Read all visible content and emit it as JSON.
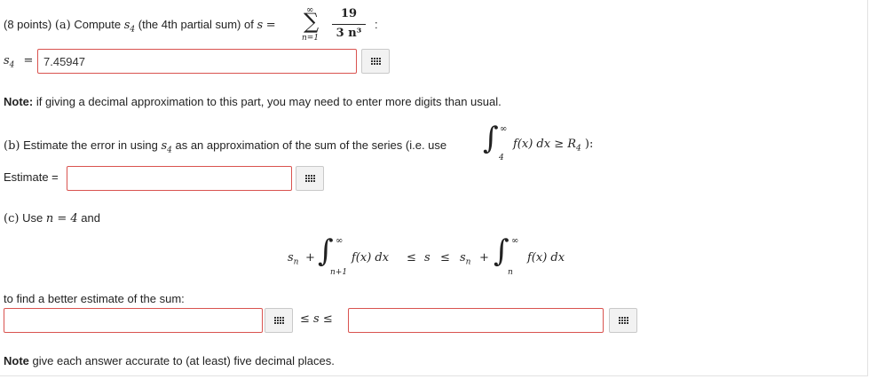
{
  "part_a": {
    "intro": "(8 points)",
    "label_a": "(a)",
    "text1": "Compute",
    "s4": "s",
    "sub4": "4",
    "text2": "(the 4th partial sum) of",
    "s": "s",
    "eq": "=",
    "sum_upper": "∞",
    "sum_lower": "n=1",
    "sigma": "∑",
    "num": "19",
    "den": "3 n³",
    "colon": ":",
    "answer_label_s": "s",
    "answer_label_sub": "4",
    "answer_label_eq": "=",
    "answer_value": "7.45947"
  },
  "note1": {
    "bold": "Note:",
    "text": "if giving a decimal approximation to this part, you may need to enter more digits than usual."
  },
  "part_b": {
    "label": "(b)",
    "text1": "Estimate the error in using",
    "s": "s",
    "sub": "4",
    "text2": "as an approximation of the sum of the series (i.e. use",
    "int_upper": "∞",
    "int_lower": "4",
    "integrand": "f(x) dx ≥ R",
    "r_sub": "4",
    "close": "):",
    "estimate_label": "Estimate =",
    "estimate_value": ""
  },
  "part_c": {
    "label": "(c)",
    "text1": "Use",
    "n_eq": "n = 4",
    "text2": "and",
    "formula": {
      "sn": "s",
      "sn_sub": "n",
      "plus": "+",
      "upper": "∞",
      "lower1": "n+1",
      "integrand": "f(x) dx",
      "le1": "≤",
      "s": "s",
      "le2": "≤",
      "sn2": "s",
      "sn2_sub": "n",
      "plus2": "+",
      "upper2": "∞",
      "lower2": "n",
      "integrand2": "f(x) dx"
    },
    "find_text": "to find a better estimate of the sum:",
    "ineq": "≤ s ≤",
    "lower_value": "",
    "upper_value": ""
  },
  "note2": {
    "bold": "Note",
    "text": "give each answer accurate to (at least) five decimal places."
  }
}
